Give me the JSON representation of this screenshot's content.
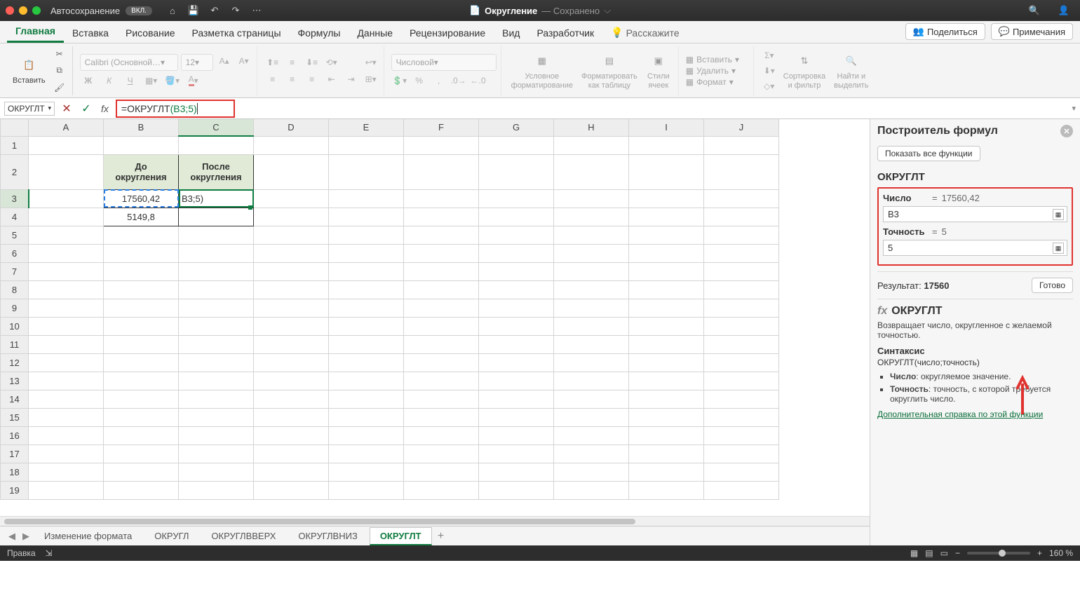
{
  "titlebar": {
    "autosave_label": "Автосохранение",
    "autosave_state": "ВКЛ.",
    "doc_name": "Округление",
    "saved": "— Сохранено"
  },
  "ribbon_tabs": [
    "Главная",
    "Вставка",
    "Рисование",
    "Разметка страницы",
    "Формулы",
    "Данные",
    "Рецензирование",
    "Вид",
    "Разработчик"
  ],
  "tell_me": "Расскажите",
  "share": "Поделиться",
  "comments": "Примечания",
  "ribbon": {
    "paste": "Вставить",
    "font_name": "Calibri (Основной…",
    "font_size": "12",
    "number_format": "Числовой",
    "cond_fmt": "Условное\nформатирование",
    "fmt_table": "Форматировать\nкак таблицу",
    "cell_styles": "Стили\nячеек",
    "insert": "Вставить",
    "delete": "Удалить",
    "format": "Формат",
    "sort": "Сортировка\nи фильтр",
    "find": "Найти и\nвыделить"
  },
  "namebox": "ОКРУГЛТ",
  "formula_prefix": "=ОКРУГЛТ",
  "formula_args": "(B3;5)",
  "columns": [
    "A",
    "B",
    "C",
    "D",
    "E",
    "F",
    "G",
    "H",
    "I",
    "J"
  ],
  "rows_count": 19,
  "cells": {
    "B2": "До\nокругления",
    "C2": "После\nокругления",
    "B3": "17560,42",
    "C3": "B3;5)",
    "B4": "5149,8"
  },
  "sheet_tabs": [
    "Изменение формата",
    "ОКРУГЛ",
    "ОКРУГЛВВЕРХ",
    "ОКРУГЛВНИЗ",
    "ОКРУГЛТ"
  ],
  "active_sheet_index": 4,
  "statusbar": {
    "mode": "Правка",
    "zoom": "160 %"
  },
  "panel": {
    "title": "Построитель формул",
    "show_all": "Показать все функции",
    "fn": "ОКРУГЛТ",
    "arg1_label": "Число",
    "arg1_preview": "17560,42",
    "arg1_value": "B3",
    "arg2_label": "Точность",
    "arg2_preview": "5",
    "arg2_value": "5",
    "result_label": "Результат:",
    "result_value": "17560",
    "done": "Готово",
    "fx_heading": "ОКРУГЛТ",
    "description": "Возвращает число, округленное с желаемой точностью.",
    "syntax_h": "Синтаксис",
    "syntax": "ОКРУГЛТ(число;точность)",
    "bullet1_term": "Число",
    "bullet1_text": ": округляемое значение.",
    "bullet2_term": "Точность",
    "bullet2_text": ": точность, с которой требуется округлить число.",
    "help_link": "Дополнительная справка по этой функции"
  }
}
